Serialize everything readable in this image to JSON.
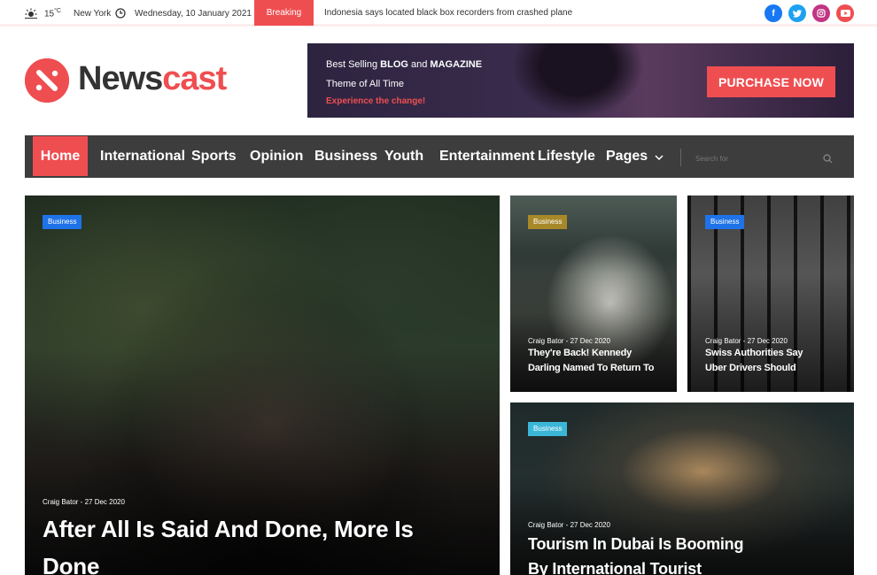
{
  "topbar": {
    "temperature": "15",
    "temp_unit": "°C",
    "city": "New York",
    "date": "Wednesday, 10 January 2021",
    "breaking_label": "Breaking News",
    "ticker": "Indonesia says located black box recorders from crashed plane",
    "weather_icon": "sun-icon",
    "clock_icon": "clock-icon",
    "social": [
      {
        "name": "facebook-icon",
        "glyph": "f",
        "color": "#1877f2"
      },
      {
        "name": "twitter-icon",
        "glyph": "t",
        "color": "#1da1f2"
      },
      {
        "name": "instagram-icon",
        "glyph": "◎",
        "color": "#c13584"
      },
      {
        "name": "youtube-icon",
        "glyph": "▶",
        "color": "#ef4e51"
      }
    ]
  },
  "logo": {
    "part1": "News",
    "part2": "cast",
    "accent": "#ef4e51"
  },
  "banner": {
    "line1_prefix": "Best Selling ",
    "line1_bold1": "BLOG",
    "line1_mid": " and ",
    "line1_bold2": "MAGAZINE",
    "line2": "Theme of All Time",
    "line3": "Experience the change!",
    "button": "PURCHASE NOW"
  },
  "nav": {
    "items": [
      "Home",
      "International",
      "Sports",
      "Opinion",
      "Business",
      "Youth",
      "Entertainment",
      "Lifestyle",
      "Pages"
    ],
    "active": "Home",
    "search_placeholder": "Search for"
  },
  "cards": [
    {
      "badge": "Business",
      "badge_color": "#1e73e8",
      "meta": "Craig Bator - 27 Dec 2020",
      "title": "After All Is Said And Done, More Is Done"
    },
    {
      "badge": "Business",
      "badge_color": "#a8892a",
      "meta": "Craig Bator - 27 Dec 2020",
      "title": "They're Back! Kennedy Darling Named To Return To"
    },
    {
      "badge": "Business",
      "badge_color": "#1e73e8",
      "meta": "Craig Bator - 27 Dec 2020",
      "title": "Swiss Authorities Say Uber Drivers Should"
    },
    {
      "badge": "Business",
      "badge_color": "#3bb6d6",
      "meta": "Craig Bator - 27 Dec 2020",
      "title": "Tourism In Dubai Is Booming By International Tourist"
    }
  ]
}
